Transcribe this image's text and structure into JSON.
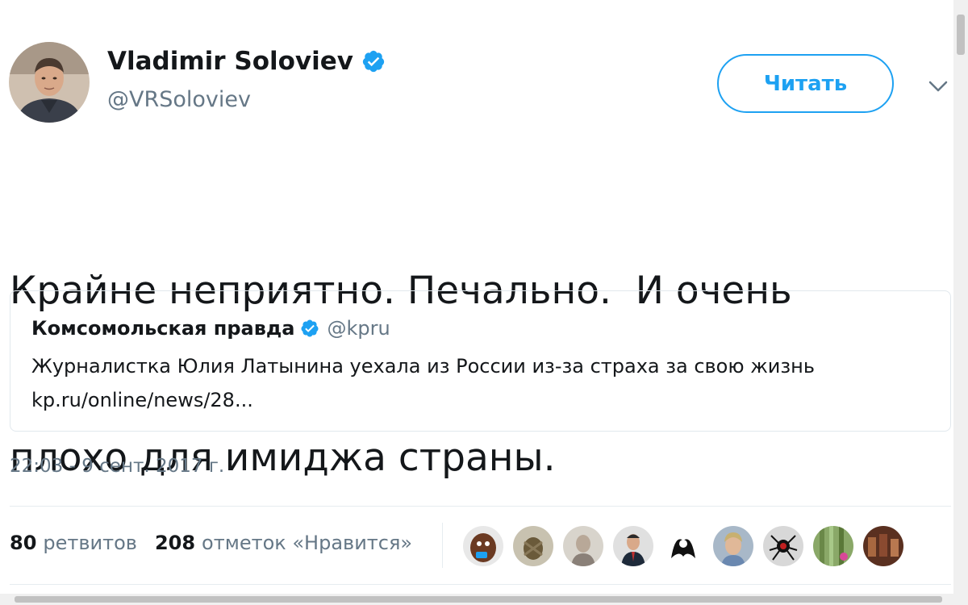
{
  "author": {
    "name": "Vladimir Soloviev",
    "handle": "@VRSoloviev",
    "verified": true
  },
  "follow_button": {
    "label": "Читать"
  },
  "tweet": {
    "text_lines": [
      "Крайне неприятно. Печально.  И очень",
      "плохо для имиджа страны."
    ]
  },
  "quoted_tweet": {
    "name": "Комсомольская правда",
    "handle": "@kpru",
    "verified": true,
    "text": "Журналистка Юлия Латынина уехала из России из-за страха за свою жизнь",
    "link": "kp.ru/online/news/28..."
  },
  "timestamp": "22:03 - 9 сент. 2017 г.",
  "stats": {
    "retweets": {
      "count": "80",
      "label": "ретвитов"
    },
    "likes": {
      "count": "208",
      "label": "отметок «Нравится»"
    }
  },
  "colors": {
    "accent": "#1da1f2",
    "text": "#14171a",
    "muted": "#657786",
    "border": "#e1e8ed"
  },
  "liker_count_shown": 9
}
